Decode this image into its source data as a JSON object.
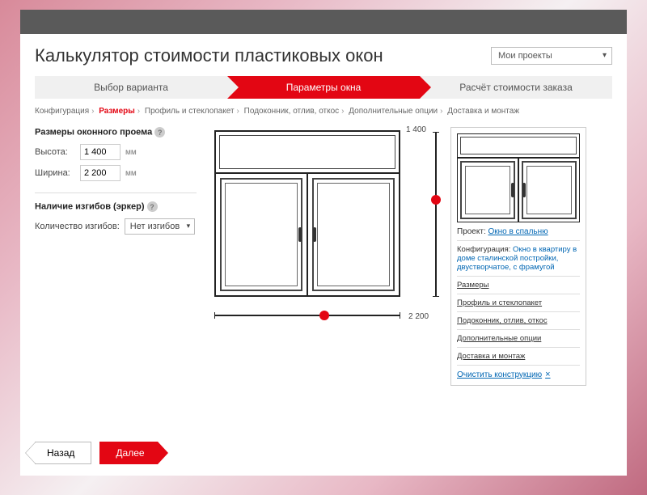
{
  "title": "Калькулятор стоимости пластиковых окон",
  "projects_dropdown": "Мои проекты",
  "steps": [
    "Выбор варианта",
    "Параметры окна",
    "Расчёт стоимости заказа"
  ],
  "crumbs": [
    "Конфигурация",
    "Размеры",
    "Профиль и стеклопакет",
    "Подоконник, отлив, откос",
    "Дополнительные опции",
    "Доставка и монтаж"
  ],
  "active_crumb_index": 1,
  "opening": {
    "title": "Размеры оконного проема",
    "height_label": "Высота:",
    "height_value": "1 400",
    "width_label": "Ширина:",
    "width_value": "2 200",
    "unit": "мм"
  },
  "bends": {
    "title": "Наличие изгибов (эркер)",
    "count_label": "Количество изгибов:",
    "selected": "Нет изгибов"
  },
  "drawing": {
    "height_dim": "1 400",
    "width_dim": "2 200"
  },
  "sidebar": {
    "project_label": "Проект:",
    "project_name": "Окно в спальню",
    "config_label": "Конфигурация:",
    "config_value": "Окно в квартиру в доме сталинской постройки, двустворчатое, с фрамугой",
    "items": [
      "Размеры",
      "Профиль и стеклопакет",
      "Подоконник, отлив, откос",
      "Дополнительные опции",
      "Доставка и монтаж"
    ],
    "clear": "Очистить конструкцию"
  },
  "nav": {
    "back": "Назад",
    "next": "Далее"
  }
}
